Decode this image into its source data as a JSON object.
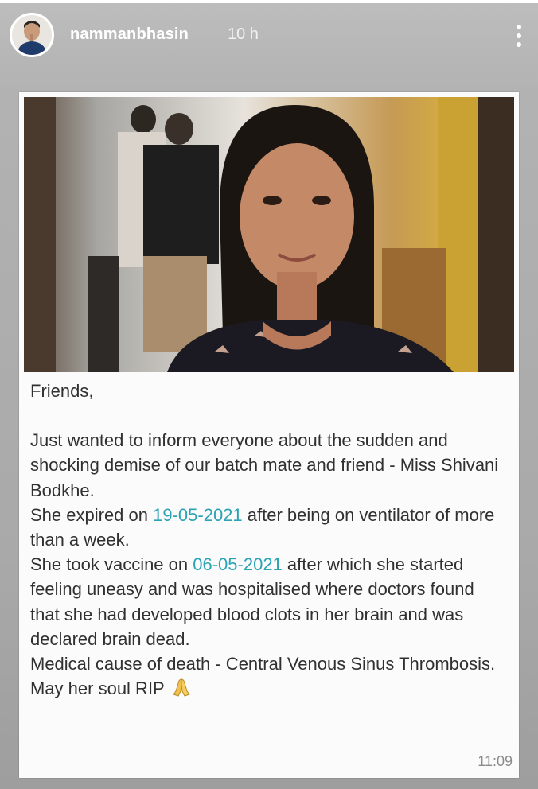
{
  "story": {
    "progress": 1.0,
    "username": "nammanbhasin",
    "time_ago": "10 h",
    "avatar_icon": "profile-avatar-icon",
    "more_icon": "more-vertical-icon"
  },
  "message": {
    "greeting": "Friends,",
    "line1": "Just wanted to inform everyone about the sudden and shocking demise of our batch mate and friend - Miss Shivani Bodkhe.",
    "line2_pre": "She expired on ",
    "line2_date": "19-05-2021",
    "line2_post": " after being on ventilator of more than a week.",
    "line3_pre": "She took vaccine on ",
    "line3_date": "06-05-2021",
    "line3_post": " after which she started feeling uneasy and was hospitalised where doctors found that she had developed blood clots in her brain and was declared brain dead.",
    "line4": "Medical cause of death - Central Venous Sinus Thrombosis.",
    "closing": "May her soul RIP",
    "closing_icon": "folded-hands-icon",
    "timestamp": "11:09"
  },
  "colors": {
    "date_link": "#2aa3b5",
    "text": "#303030",
    "timestamp": "#8a8a8a"
  }
}
